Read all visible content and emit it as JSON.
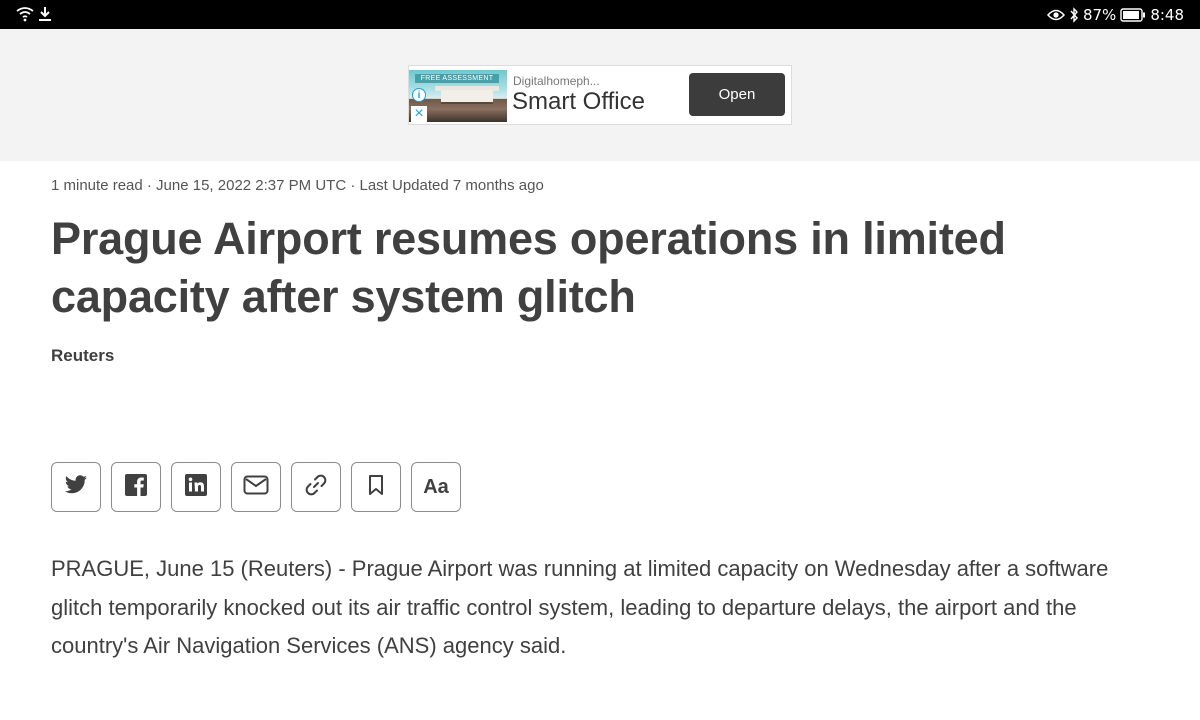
{
  "status_bar": {
    "battery": "87%",
    "time": "8:48"
  },
  "ad": {
    "image_tag": "FREE ASSESSMENT",
    "advertiser": "Digitalhomeph...",
    "title": "Smart Office",
    "cta": "Open",
    "info_icon": "info-icon",
    "close_icon": "close-icon"
  },
  "article": {
    "meta": "1 minute read · June 15, 2022 2:37 PM UTC · Last Updated 7 months ago",
    "headline": "Prague Airport resumes operations in limited capacity after system glitch",
    "byline": "Reuters",
    "body": "PRAGUE, June 15 (Reuters) - Prague Airport was running at limited capacity on Wednesday after a software glitch temporarily knocked out its air traffic control system, leading to departure delays, the airport and the country's Air Navigation Services (ANS) agency said."
  },
  "share_buttons": [
    {
      "icon": "twitter-icon"
    },
    {
      "icon": "facebook-icon"
    },
    {
      "icon": "linkedin-icon"
    },
    {
      "icon": "email-icon"
    },
    {
      "icon": "link-icon"
    },
    {
      "icon": "bookmark-icon"
    },
    {
      "label": "Aa"
    }
  ]
}
